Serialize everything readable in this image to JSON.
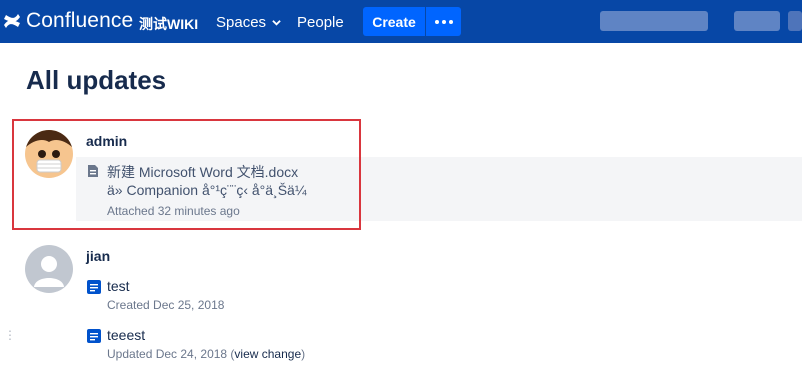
{
  "header": {
    "brand": "Confluence",
    "space_name": "测试WIKI",
    "nav_spaces": "Spaces",
    "nav_people": "People",
    "create_label": "Create",
    "colors": {
      "bar": "#0747a6",
      "button": "#0065ff"
    }
  },
  "page": {
    "title": "All updates"
  },
  "updates": [
    {
      "user": "admin",
      "items": [
        {
          "icon": "attachment-file-icon",
          "title": "新建 Microsoft Word 文档.docx",
          "subtitle": "ä» Companion å°¹ç¨¨ç‹ å°ä¸Šä¼",
          "meta": "Attached 32 minutes ago"
        }
      ]
    },
    {
      "user": "jian",
      "items": [
        {
          "icon": "page-icon",
          "title": "test",
          "meta": "Created Dec 25, 2018"
        },
        {
          "icon": "page-icon",
          "title": "teeest",
          "meta_prefix": "Updated Dec 24, 2018 (",
          "meta_link": "view change",
          "meta_suffix": ")"
        }
      ]
    }
  ]
}
